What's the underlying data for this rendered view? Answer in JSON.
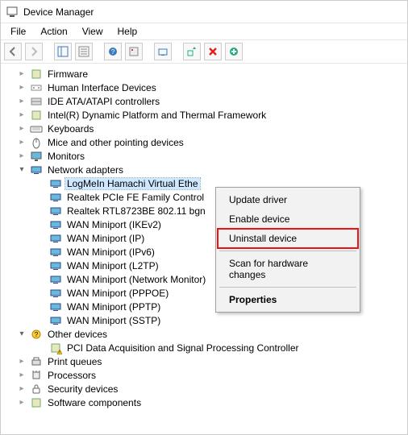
{
  "window": {
    "title": "Device Manager"
  },
  "menu": {
    "file": "File",
    "action": "Action",
    "view": "View",
    "help": "Help"
  },
  "tree": {
    "cat": {
      "firmware": "Firmware",
      "hid": "Human Interface Devices",
      "ide": "IDE ATA/ATAPI controllers",
      "intel": "Intel(R) Dynamic Platform and Thermal Framework",
      "keyboards": "Keyboards",
      "mice": "Mice and other pointing devices",
      "monitors": "Monitors",
      "network": "Network adapters",
      "other": "Other devices",
      "print": "Print queues",
      "processors": "Processors",
      "security": "Security devices",
      "software": "Software components"
    },
    "network_items": [
      "LogMeIn Hamachi Virtual Ethe",
      "Realtek PCIe FE Family Control",
      "Realtek RTL8723BE 802.11 bgn ",
      "WAN Miniport (IKEv2)",
      "WAN Miniport (IP)",
      "WAN Miniport (IPv6)",
      "WAN Miniport (L2TP)",
      "WAN Miniport (Network Monitor)",
      "WAN Miniport (PPPOE)",
      "WAN Miniport (PPTP)",
      "WAN Miniport (SSTP)"
    ],
    "other_items": [
      "PCI Data Acquisition and Signal Processing Controller"
    ]
  },
  "context": {
    "update": "Update driver",
    "enable": "Enable device",
    "uninstall": "Uninstall device",
    "scan": "Scan for hardware changes",
    "properties": "Properties"
  }
}
